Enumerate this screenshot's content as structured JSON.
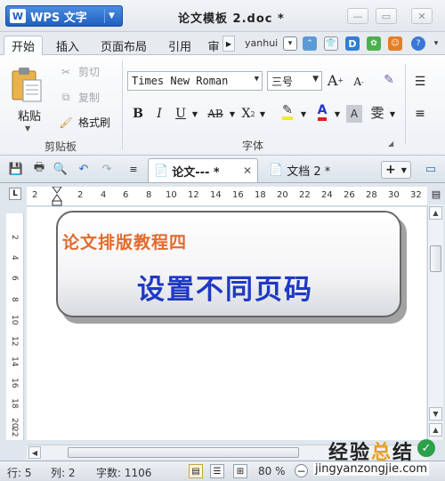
{
  "app": {
    "menu_button_label": "WPS 文字",
    "logo_letter": "W",
    "document_title": "论文模板 2.doc *"
  },
  "menu": {
    "tabs": [
      "开始",
      "插入",
      "页面布局",
      "引用",
      "审"
    ],
    "user": "yanhui"
  },
  "clipboard": {
    "paste": "粘贴",
    "cut": "剪切",
    "copy": "复制",
    "format_painter": "格式刷",
    "group_label": "剪贴板"
  },
  "font": {
    "name": "Times New Roman",
    "size": "三号",
    "grow": "A",
    "shrink": "A",
    "bold": "B",
    "italic": "I",
    "underline": "U",
    "strike": "AB",
    "superscript": "X",
    "color_a": "A",
    "shade_a": "A",
    "phonetic": "雯",
    "group_label": "字体"
  },
  "doc_tabs": [
    {
      "label": "论文--- *"
    },
    {
      "label": "文档 2 *"
    }
  ],
  "ruler": {
    "ticks": [
      "2",
      "2",
      "4",
      "6",
      "8",
      "10",
      "12",
      "14",
      "16",
      "18",
      "20",
      "22",
      "24",
      "26",
      "28",
      "30",
      "32"
    ],
    "vticks": [
      "2",
      "4",
      "6",
      "8",
      "10",
      "12",
      "14",
      "16",
      "18",
      "20",
      "22"
    ],
    "corner": "L"
  },
  "document": {
    "subtitle": "论文排版教程四",
    "title": "设置不同页码"
  },
  "status": {
    "line": "行: 5",
    "column": "列: 2",
    "word_count": "字数: 1106",
    "zoom": "80 %"
  },
  "watermark": {
    "cn_left": "经验",
    "cn_mid": "总",
    "cn_right": "结",
    "url": "jingyanzongjie.com"
  },
  "colors": {
    "subtitle": "#e46a2b",
    "title": "#1f38c6",
    "wps_button": "#1f5fc0"
  }
}
